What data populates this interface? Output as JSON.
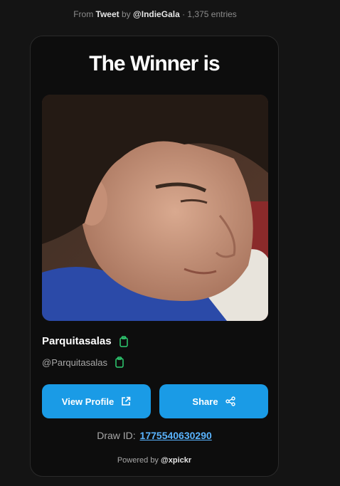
{
  "meta": {
    "from_label": "From",
    "source": "Tweet",
    "by_label": "by",
    "account": "@IndieGala",
    "entries": "· 1,375 entries"
  },
  "card": {
    "title": "The Winner is",
    "winner": {
      "name": "Parquitasalas",
      "handle": "@Parquitasalas"
    },
    "buttons": {
      "view_profile": "View Profile",
      "share": "Share"
    },
    "draw": {
      "label": "Draw ID:",
      "id": "1775540630290"
    },
    "powered": {
      "label": "Powered by",
      "brand": "@xpickr"
    }
  },
  "colors": {
    "accent": "#1a9be6",
    "copy_icon": "#2ecc71",
    "link": "#5ab4ff"
  },
  "icons": {
    "copy": "clipboard-icon",
    "external": "external-link-icon",
    "share": "share-icon"
  }
}
